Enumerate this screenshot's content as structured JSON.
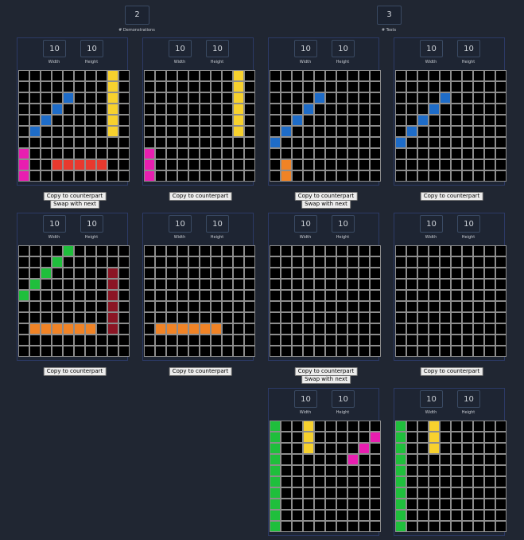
{
  "demonstrations": {
    "count": "2",
    "label": "# Demonstrations"
  },
  "tests": {
    "count": "3",
    "label": "# Tests"
  },
  "palette": {
    "1": "#1E6CC8",
    "2": "#E8392E",
    "3": "#1FBF3C",
    "4": "#F7D12E",
    "5": "#9B9B9B",
    "6": "#E81EB0",
    "7": "#F08326",
    "9": "#8B1524"
  },
  "labels": {
    "width": "Width",
    "height": "Height",
    "copy": "Copy to counterpart",
    "swap": "Swap with next"
  },
  "panels": [
    {
      "width": "10",
      "height": "10",
      "grid": [
        "0000000040",
        "0000000040",
        "0000100040",
        "0001000040",
        "0010000040",
        "0100000040",
        "0000000000",
        "6000000000",
        "6002222200",
        "6000000000"
      ]
    },
    {
      "width": "10",
      "height": "10",
      "grid": [
        "0000000040",
        "0000000040",
        "0000000040",
        "0000000040",
        "0000000040",
        "0000000040",
        "0000000000",
        "6000000000",
        "6000000000",
        "6000000000"
      ]
    },
    {
      "width": "10",
      "height": "10",
      "grid": [
        "0000000000",
        "0000000000",
        "0000100000",
        "0001000000",
        "0010000000",
        "0100000000",
        "1000000000",
        "0000000000",
        "0700000000",
        "0700000000"
      ]
    },
    {
      "width": "10",
      "height": "10",
      "grid": [
        "0000000000",
        "0000000000",
        "0000100000",
        "0001000000",
        "0010000000",
        "0100000000",
        "1000000000",
        "0000000000",
        "0000000000",
        "0000000000"
      ]
    },
    {
      "width": "10",
      "height": "10",
      "grid": [
        "0000300000",
        "0003000000",
        "0030000090",
        "0300000090",
        "3000000090",
        "0000000090",
        "0000000090",
        "0777777090",
        "0000000000",
        "0000000000"
      ]
    },
    {
      "width": "10",
      "height": "10",
      "grid": [
        "0000000000",
        "0000000000",
        "0000000000",
        "0000000000",
        "0000000000",
        "0000000000",
        "0000000000",
        "0777777000",
        "0000000000",
        "0000000000"
      ]
    },
    {
      "width": "10",
      "height": "10",
      "grid": [
        "0000000000",
        "0000000000",
        "0000000000",
        "0000000000",
        "0000000000",
        "0000000000",
        "0000000000",
        "0000000000",
        "0000000000",
        "0000000000"
      ]
    },
    {
      "width": "10",
      "height": "10",
      "grid": [
        "0000000000",
        "0000000000",
        "0000000000",
        "0000000000",
        "0000000000",
        "0000000000",
        "0000000000",
        "0000000000",
        "0000000000",
        "0000000000"
      ]
    },
    {
      "width": "10",
      "height": "10",
      "grid": [
        "3004000000",
        "3004000006",
        "3004000060",
        "3000000600",
        "3000000000",
        "3000000000",
        "3000000000",
        "3000000000",
        "3000000000",
        "3000000000"
      ]
    },
    {
      "width": "10",
      "height": "10",
      "grid": [
        "3004000000",
        "3004000000",
        "3004000000",
        "3000000000",
        "3000000000",
        "3000000000",
        "3000000000",
        "3000000000",
        "3000000000",
        "3000000000"
      ]
    }
  ]
}
